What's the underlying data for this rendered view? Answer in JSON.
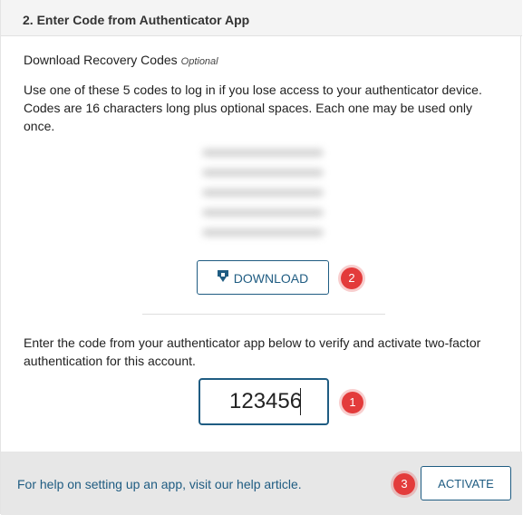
{
  "header": {
    "title": "2. Enter Code from Authenticator App"
  },
  "recovery": {
    "title": "Download Recovery Codes",
    "optional_label": "Optional",
    "description": "Use one of these 5 codes to log in if you lose access to your authenticator device. Codes are 16 characters long plus optional spaces. Each one may be used only once.",
    "download_label": "DOWNLOAD",
    "download_icon": "download-icon",
    "download_step": "2"
  },
  "verify": {
    "description": "Enter the code from your authenticator app below to verify and activate two-factor authentication for this account.",
    "code_value": "123456",
    "code_step": "1"
  },
  "footer": {
    "help_text": "For help on setting up an app, visit our help article.",
    "activate_label": "ACTIVATE",
    "activate_step": "3"
  },
  "colors": {
    "accent": "#1f5c82",
    "badge": "#e33b3b",
    "footer_bg": "#e7e7e7",
    "header_bg": "#f4f4f4"
  }
}
